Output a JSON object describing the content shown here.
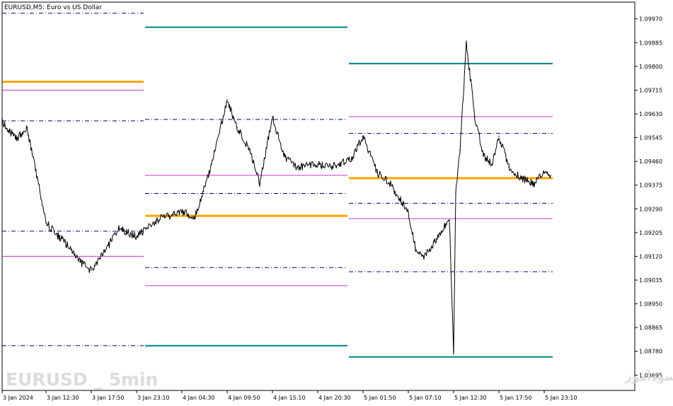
{
  "chart_data": {
    "type": "line",
    "title": "EURUSD,M5:  Euro vs US Dollar",
    "watermark_left": "EURUSD _ 5min",
    "watermark_right": "انتشار در سایت سودآموز",
    "ylim": [
      1.0864,
      1.1003
    ],
    "y_ticks": [
      "1.09970",
      "1.09885",
      "1.09800",
      "1.09715",
      "1.09630",
      "1.09545",
      "1.09460",
      "1.09375",
      "1.09290",
      "1.09205",
      "1.09120",
      "1.09035",
      "1.08950",
      "1.08865",
      "1.08780",
      "1.08695"
    ],
    "x_ticks": [
      "3 Jan 2024",
      "3 Jan 12:30",
      "3 Jan 17:50",
      "3 Jan 23:10",
      "4 Jan 04:30",
      "4 Jan 09:50",
      "4 Jan 15:10",
      "4 Jan 20:30",
      "5 Jan 01:50",
      "5 Jan 07:10",
      "5 Jan 12:30",
      "5 Jan 17:50",
      "5 Jan 23:10"
    ],
    "colors": {
      "price": "#000000",
      "pivot": "#ffa500",
      "support_resistance_1": "#cc33cc",
      "support_resistance_2": "#000080",
      "support_resistance_3": "#008080",
      "axis": "#000000",
      "watermark": "#dcdcdc"
    },
    "grid": false,
    "session_levels": [
      {
        "session": "3 Jan",
        "pivot": 1.09745,
        "r1": 1.09715,
        "s1": 1.0912,
        "r2": 1.09605,
        "s2": 1.0921,
        "r3": 1.0999,
        "s3": 1.088
      },
      {
        "session": "4 Jan",
        "pivot": 1.09265,
        "r1": 1.0941,
        "s1": 1.09015,
        "r2": 1.0961,
        "s2": 1.09345,
        "s2b": 1.0908,
        "r3": 1.0994,
        "s3": 1.088
      },
      {
        "session": "5 Jan",
        "pivot": 1.094,
        "r1": 1.0962,
        "s1": 1.09255,
        "r2": 1.0956,
        "s2": 1.0931,
        "s2b": 1.09065,
        "r3": 1.0981,
        "s3": 1.0876
      }
    ],
    "price_series": {
      "name": "EURUSD",
      "x": [
        "3 Jan 2024",
        "3 Jan 04:00",
        "3 Jan 07:00",
        "3 Jan 10:00",
        "3 Jan 12:30",
        "3 Jan 15:00",
        "3 Jan 16:30",
        "3 Jan 17:50",
        "3 Jan 19:30",
        "3 Jan 21:00",
        "3 Jan 23:10",
        "4 Jan 01:30",
        "4 Jan 04:30",
        "4 Jan 06:00",
        "4 Jan 08:00",
        "4 Jan 09:50",
        "4 Jan 11:00",
        "4 Jan 12:30",
        "4 Jan 13:40",
        "4 Jan 15:10",
        "4 Jan 16:30",
        "4 Jan 18:00",
        "4 Jan 20:30",
        "4 Jan 22:00",
        "5 Jan 00:30",
        "5 Jan 01:50",
        "5 Jan 03:30",
        "5 Jan 05:00",
        "5 Jan 07:10",
        "5 Jan 08:00",
        "5 Jan 09:00",
        "5 Jan 10:30",
        "5 Jan 11:30",
        "5 Jan 12:00",
        "5 Jan 12:30",
        "5 Jan 12:45",
        "5 Jan 13:15",
        "5 Jan 14:00",
        "5 Jan 15:00",
        "5 Jan 16:00",
        "5 Jan 17:00",
        "5 Jan 17:50",
        "5 Jan 19:00",
        "5 Jan 20:30",
        "5 Jan 22:00",
        "5 Jan 23:10",
        "5 Jan 23:55"
      ],
      "values": [
        1.096,
        1.0954,
        1.0958,
        1.094,
        1.0924,
        1.0916,
        1.091,
        1.0907,
        1.0914,
        1.0922,
        1.0919,
        1.0925,
        1.0928,
        1.0926,
        1.0945,
        1.0968,
        1.0958,
        1.095,
        1.0938,
        1.0962,
        1.0948,
        1.0944,
        1.0945,
        1.0944,
        1.0947,
        1.0955,
        1.0942,
        1.0938,
        1.0928,
        1.0915,
        1.0912,
        1.0918,
        1.0923,
        1.0925,
        1.0878,
        1.0935,
        1.095,
        1.0988,
        1.0962,
        1.0948,
        1.0945,
        1.0955,
        1.0944,
        1.094,
        1.0938,
        1.0942,
        1.0941
      ]
    }
  }
}
